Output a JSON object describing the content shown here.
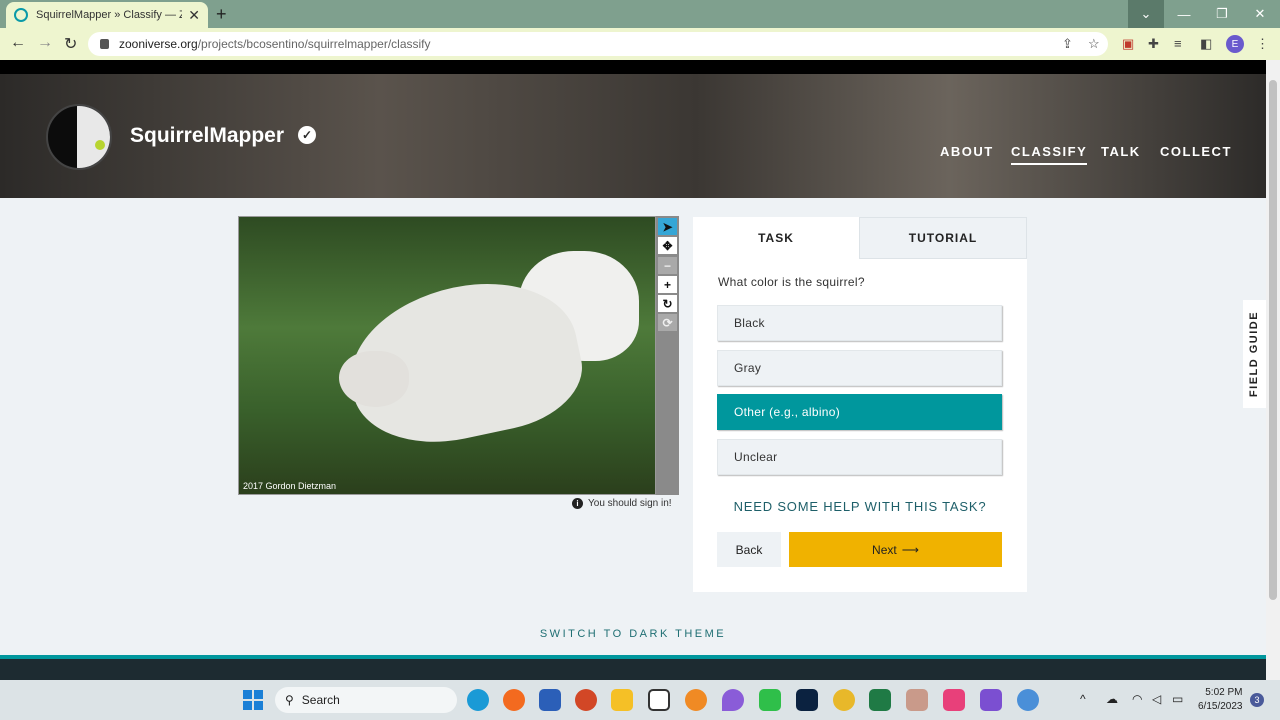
{
  "browser": {
    "tab_title": "SquirrelMapper » Classify — Zoo",
    "tab_close": "✕",
    "new_tab": "+",
    "url_host": "zooniverse.org",
    "url_path": "/projects/bcosentino/squirrelmapper/classify",
    "profile_initial": "E",
    "window_controls": [
      "⌄",
      "—",
      "❐",
      "✕"
    ]
  },
  "header": {
    "project_name": "SquirrelMapper",
    "nav": [
      {
        "label": "ABOUT",
        "active": false
      },
      {
        "label": "CLASSIFY",
        "active": true
      },
      {
        "label": "TALK",
        "active": false
      },
      {
        "label": "COLLECT",
        "active": false
      }
    ]
  },
  "subject": {
    "credit": "2017 Gordon Dietzman",
    "sign_in_notice": "You should sign in!"
  },
  "panel": {
    "tabs": [
      "TASK",
      "TUTORIAL"
    ],
    "question": "What color is the squirrel?",
    "answers": [
      {
        "label": "Black",
        "selected": false
      },
      {
        "label": "Gray",
        "selected": false
      },
      {
        "label": "Other (e.g., albino)",
        "selected": true
      },
      {
        "label": "Unclear",
        "selected": false
      }
    ],
    "help": "NEED SOME HELP WITH THIS TASK?",
    "back": "Back",
    "next": "Next"
  },
  "field_guide": "FIELD GUIDE",
  "theme_toggle": "SWITCH TO DARK THEME",
  "taskbar": {
    "search": "Search",
    "time": "5:02 PM",
    "date": "6/15/2023",
    "notifications": "3"
  },
  "colors": {
    "teal": "#00979d",
    "next_yellow": "#f0b200",
    "browser_frame": "#eef5cf",
    "page_bg": "#eef2f5"
  }
}
